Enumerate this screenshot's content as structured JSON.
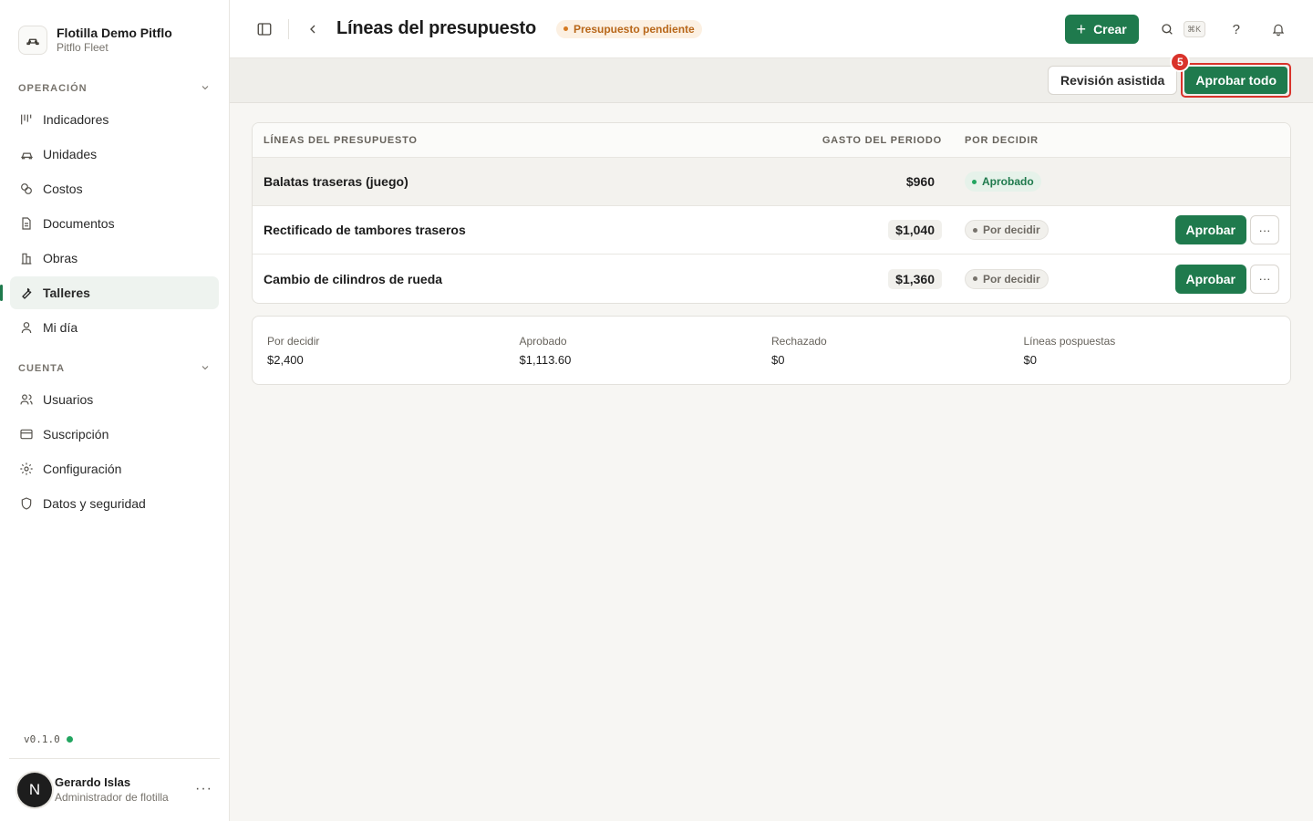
{
  "brand": {
    "name": "Flotilla Demo Pitflo",
    "subtitle": "Pitflo Fleet"
  },
  "sidebar": {
    "sections": [
      {
        "title": "OPERACIÓN",
        "items": [
          {
            "label": "Indicadores",
            "icon": "kanban-icon"
          },
          {
            "label": "Unidades",
            "icon": "car-icon"
          },
          {
            "label": "Costos",
            "icon": "coins-icon"
          },
          {
            "label": "Documentos",
            "icon": "file-icon"
          },
          {
            "label": "Obras",
            "icon": "building-icon"
          },
          {
            "label": "Talleres",
            "icon": "wrench-icon",
            "active": true
          },
          {
            "label": "Mi día",
            "icon": "user-icon"
          }
        ]
      },
      {
        "title": "CUENTA",
        "items": [
          {
            "label": "Usuarios",
            "icon": "users-icon"
          },
          {
            "label": "Suscripción",
            "icon": "credit-card-icon"
          },
          {
            "label": "Configuración",
            "icon": "gear-icon"
          },
          {
            "label": "Datos y seguridad",
            "icon": "shield-icon"
          }
        ]
      }
    ],
    "version": "v0.1.0",
    "user": {
      "initial": "N",
      "name": "Gerardo Islas",
      "role": "Administrador de flotilla"
    }
  },
  "header": {
    "title": "Líneas del presupuesto",
    "status": "Presupuesto pendiente",
    "create_label": "Crear",
    "shortcut": "⌘K",
    "help": "?"
  },
  "actions": {
    "assisted_review": "Revisión asistida",
    "approve_all": "Aprobar todo",
    "approve_all_badge": "5"
  },
  "table": {
    "headers": {
      "name": "LÍNEAS DEL PRESUPUESTO",
      "amount": "GASTO DEL PERIODO",
      "status": "POR DECIDIR"
    },
    "rows": [
      {
        "name": "Balatas traseras (juego)",
        "amount": "$960",
        "status": "Aprobado"
      },
      {
        "name": "Rectificado de tambores traseros",
        "amount": "$1,040",
        "status": "Por decidir",
        "action": "Aprobar"
      },
      {
        "name": "Cambio de cilindros de rueda",
        "amount": "$1,360",
        "status": "Por decidir",
        "action": "Aprobar"
      }
    ]
  },
  "summary": [
    {
      "label": "Por decidir",
      "value": "$2,400"
    },
    {
      "label": "Aprobado",
      "value": "$1,113.60"
    },
    {
      "label": "Rechazado",
      "value": "$0"
    },
    {
      "label": "Líneas pospuestas",
      "value": "$0"
    }
  ],
  "colors": {
    "accent": "#1f7a4d",
    "warning": "#b8671a",
    "highlight": "#d9332b"
  }
}
